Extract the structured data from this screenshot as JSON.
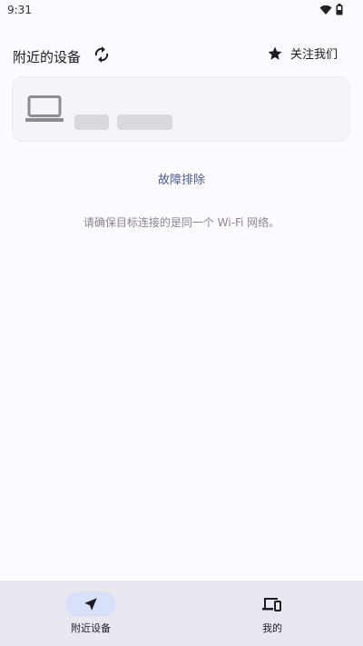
{
  "status_bar": {
    "time": "9:31",
    "icons": [
      "wifi-icon",
      "battery-icon"
    ]
  },
  "header": {
    "title": "附近的设备",
    "refresh_icon": "refresh-icon",
    "follow_icon": "star-icon",
    "follow_label": "关注我们"
  },
  "device_card": {
    "icon": "laptop-icon"
  },
  "troubleshoot": {
    "label": "故障排除"
  },
  "hint": {
    "text": "请确保目标连接的是同一个 Wi-Fi 网络。"
  },
  "bottom_nav": {
    "items": [
      {
        "label": "附近设备",
        "icon": "navigation-arrow-icon",
        "active": true
      },
      {
        "label": "我的",
        "icon": "devices-icon",
        "active": false
      }
    ]
  },
  "colors": {
    "background": "#fcfafe",
    "card": "#f6f3f9",
    "link": "#4a5a8f",
    "nav_background": "#ebe7f1",
    "nav_active_pill": "#d9e1f8"
  }
}
